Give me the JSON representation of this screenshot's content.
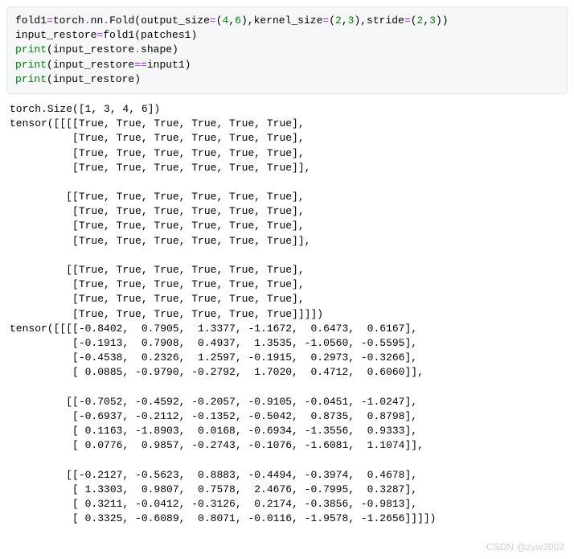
{
  "code": {
    "line1_a": "fold1",
    "line1_eq": "=",
    "line1_b": "torch",
    "line1_dot1": ".",
    "line1_c": "nn",
    "line1_dot2": ".",
    "line1_d": "Fold(output_size",
    "line1_eq2": "=",
    "line1_e": "(",
    "line1_n1": "4",
    "line1_f": ",",
    "line1_n2": "6",
    "line1_g": "),kernel_size",
    "line1_eq3": "=",
    "line1_h": "(",
    "line1_n3": "2",
    "line1_i": ",",
    "line1_n4": "3",
    "line1_j": "),stride",
    "line1_eq4": "=",
    "line1_k": "(",
    "line1_n5": "2",
    "line1_l": ",",
    "line1_n6": "3",
    "line1_m": "))",
    "line2_a": "input_restore",
    "line2_eq": "=",
    "line2_b": "fold1(patches1)",
    "line3_a": "print",
    "line3_b": "(input_restore",
    "line3_dot": ".",
    "line3_c": "shape)",
    "line4_a": "print",
    "line4_b": "(input_restore",
    "line4_op": "==",
    "line4_c": "input1)",
    "line5_a": "print",
    "line5_b": "(input_restore)"
  },
  "output": "torch.Size([1, 3, 4, 6])\ntensor([[[[True, True, True, True, True, True],\n          [True, True, True, True, True, True],\n          [True, True, True, True, True, True],\n          [True, True, True, True, True, True]],\n\n         [[True, True, True, True, True, True],\n          [True, True, True, True, True, True],\n          [True, True, True, True, True, True],\n          [True, True, True, True, True, True]],\n\n         [[True, True, True, True, True, True],\n          [True, True, True, True, True, True],\n          [True, True, True, True, True, True],\n          [True, True, True, True, True, True]]]])\ntensor([[[[-0.8402,  0.7905,  1.3377, -1.1672,  0.6473,  0.6167],\n          [-0.1913,  0.7908,  0.4937,  1.3535, -1.0560, -0.5595],\n          [-0.4538,  0.2326,  1.2597, -0.1915,  0.2973, -0.3266],\n          [ 0.0885, -0.9790, -0.2792,  1.7020,  0.4712,  0.6060]],\n\n         [[-0.7052, -0.4592, -0.2057, -0.9105, -0.0451, -1.0247],\n          [-0.6937, -0.2112, -0.1352, -0.5042,  0.8735,  0.8798],\n          [ 0.1163, -1.8903,  0.0168, -0.6934, -1.3556,  0.9333],\n          [ 0.0776,  0.9857, -0.2743, -0.1076, -1.6081,  1.1074]],\n\n         [[-0.2127, -0.5623,  0.8883, -0.4494, -0.3974,  0.4678],\n          [ 1.3303,  0.9807,  0.7578,  2.4676, -0.7995,  0.3287],\n          [ 0.3211, -0.0412, -0.3126,  0.2174, -0.3856, -0.9813],\n          [ 0.3325, -0.6089,  0.8071, -0.0116, -1.9578, -1.2656]]]])",
  "watermark": "CSDN @zyw2002",
  "chart_data": {
    "type": "table",
    "title": "PyTorch Fold output",
    "shape": [
      1,
      3,
      4,
      6
    ],
    "boolean_tensor": {
      "shape": [
        1,
        3,
        4,
        6
      ],
      "all_values": true
    },
    "float_tensor": [
      [
        [
          -0.8402,
          0.7905,
          1.3377,
          -1.1672,
          0.6473,
          0.6167
        ],
        [
          -0.1913,
          0.7908,
          0.4937,
          1.3535,
          -1.056,
          -0.5595
        ],
        [
          -0.4538,
          0.2326,
          1.2597,
          -0.1915,
          0.2973,
          -0.3266
        ],
        [
          0.0885,
          -0.979,
          -0.2792,
          1.702,
          0.4712,
          0.606
        ]
      ],
      [
        [
          -0.7052,
          -0.4592,
          -0.2057,
          -0.9105,
          -0.0451,
          -1.0247
        ],
        [
          -0.6937,
          -0.2112,
          -0.1352,
          -0.5042,
          0.8735,
          0.8798
        ],
        [
          0.1163,
          -1.8903,
          0.0168,
          -0.6934,
          -1.3556,
          0.9333
        ],
        [
          0.0776,
          0.9857,
          -0.2743,
          -0.1076,
          -1.6081,
          1.1074
        ]
      ],
      [
        [
          -0.2127,
          -0.5623,
          0.8883,
          -0.4494,
          -0.3974,
          0.4678
        ],
        [
          1.3303,
          0.9807,
          0.7578,
          2.4676,
          -0.7995,
          0.3287
        ],
        [
          0.3211,
          -0.0412,
          -0.3126,
          0.2174,
          -0.3856,
          -0.9813
        ],
        [
          0.3325,
          -0.6089,
          0.8071,
          -0.0116,
          -1.9578,
          -1.2656
        ]
      ]
    ]
  }
}
